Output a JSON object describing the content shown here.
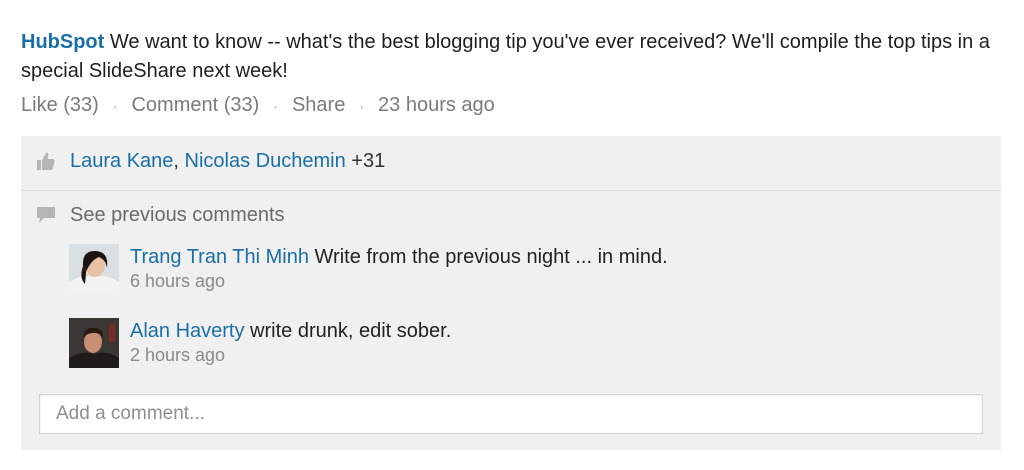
{
  "post": {
    "author": "HubSpot",
    "text": " We want to know -- what's the best blogging tip you've ever received? We'll compile the top tips in a special SlideShare next week!"
  },
  "actions": {
    "like": "Like (33)",
    "comment": "Comment (33)",
    "share": "Share",
    "separator": "·",
    "time": "23 hours ago"
  },
  "likes": {
    "name1": "Laura Kane",
    "comma": ",",
    "name2": "Nicolas Duchemin",
    "more": " +31",
    "icon": "thumbs-up-icon"
  },
  "previous": {
    "label": "See previous comments",
    "icon": "speech-bubble-icon"
  },
  "comments": [
    {
      "author": "Trang Tran Thi Minh",
      "text": " Write from the previous night ... in mind.",
      "time": "6 hours ago"
    },
    {
      "author": "Alan Haverty",
      "text": " write drunk, edit sober.",
      "time": "2 hours ago"
    }
  ],
  "input": {
    "placeholder": "Add a comment..."
  },
  "colors": {
    "link": "#1a6fa6",
    "panel": "#f0f0f0",
    "muted": "#7b7b7b"
  }
}
